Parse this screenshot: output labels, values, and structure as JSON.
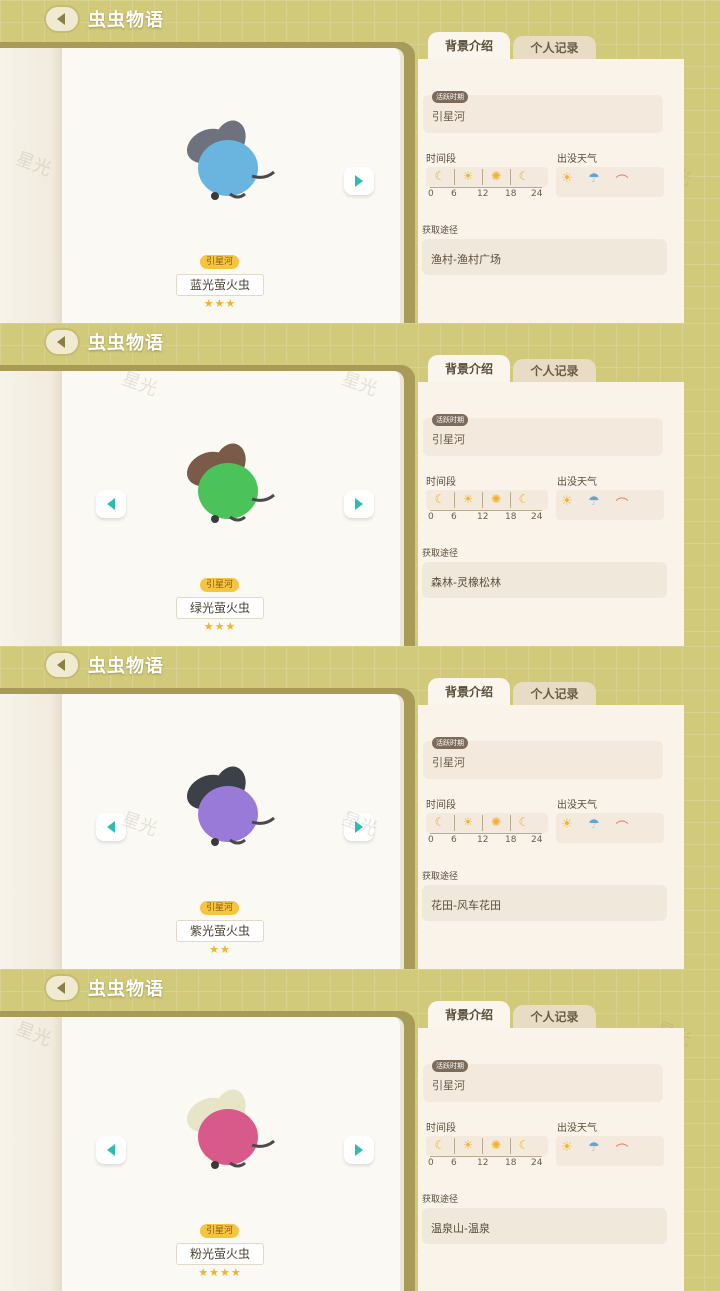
{
  "header": {
    "title": "虫虫物语"
  },
  "tabs": {
    "active": "背景介绍",
    "inactive": "个人记录"
  },
  "labels": {
    "active_time": "活跃时期",
    "time_period": "时间段",
    "weather": "出没天气",
    "source": "获取途径"
  },
  "time_ticks": [
    "0",
    "6",
    "12",
    "18",
    "24"
  ],
  "time_icons": [
    "moon-icon",
    "sunrise-icon",
    "sun-icon",
    "moon-icon"
  ],
  "weather_icons": [
    "sun-icon",
    "rain-icon",
    "rainbow-icon"
  ],
  "watermark": "星光",
  "frames": [
    {
      "name": "蓝光萤火虫",
      "location": "引星河",
      "region": "引星河",
      "source": "渔村-渔村广场",
      "stars": 3,
      "stars_text": "★★★",
      "color": "#6ab4e0",
      "wing": "#6e727e",
      "show_left": false
    },
    {
      "name": "绿光萤火虫",
      "location": "引星河",
      "region": "引星河",
      "source": "森林-灵橡松林",
      "stars": 3,
      "stars_text": "★★★",
      "color": "#4cc35a",
      "wing": "#7a5a48",
      "show_left": true
    },
    {
      "name": "紫光萤火虫",
      "location": "引星河",
      "region": "引星河",
      "source": "花田-风车花田",
      "stars": 2,
      "stars_text": "★★",
      "color": "#9a7ad8",
      "wing": "#3c4048",
      "show_left": true
    },
    {
      "name": "粉光萤火虫",
      "location": "引星河",
      "region": "引星河",
      "source": "温泉山-温泉",
      "stars": 4,
      "stars_text": "★★★★",
      "color": "#d85a8a",
      "wing": "#e8e4c8",
      "show_left": true
    }
  ]
}
